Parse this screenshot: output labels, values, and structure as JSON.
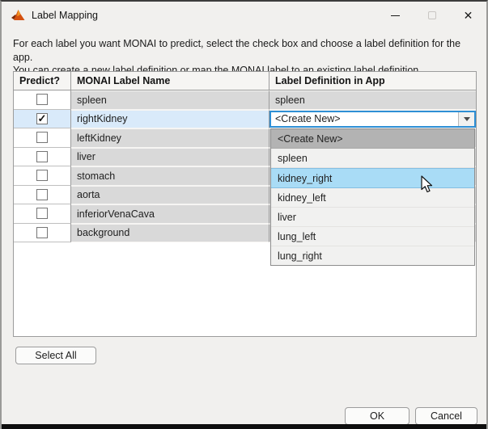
{
  "window": {
    "title": "Label Mapping"
  },
  "instructions": {
    "line1": "For each label you want MONAI to predict, select the check box and choose a label definition for the app.",
    "line2": "You can create a new label definition or map the MONAI label to an existing label definition"
  },
  "table": {
    "columns": [
      "Predict?",
      "MONAI Label Name",
      "Label Definition in App"
    ],
    "rows": [
      {
        "monai_label": "spleen",
        "checked": false,
        "selected": false,
        "definition": "spleen"
      },
      {
        "monai_label": "rightKidney",
        "checked": true,
        "selected": true,
        "definition": "<Create New>"
      },
      {
        "monai_label": "leftKidney",
        "checked": false,
        "selected": false,
        "definition": ""
      },
      {
        "monai_label": "liver",
        "checked": false,
        "selected": false,
        "definition": ""
      },
      {
        "monai_label": "stomach",
        "checked": false,
        "selected": false,
        "definition": ""
      },
      {
        "monai_label": "aorta",
        "checked": false,
        "selected": false,
        "definition": ""
      },
      {
        "monai_label": "inferiorVenaCava",
        "checked": false,
        "selected": false,
        "definition": ""
      },
      {
        "monai_label": "background",
        "checked": false,
        "selected": false,
        "definition": ""
      }
    ]
  },
  "combobox": {
    "value": "<Create New>"
  },
  "dropdown": {
    "options": [
      "<Create New>",
      "spleen",
      "kidney_right",
      "kidney_left",
      "liver",
      "lung_left",
      "lung_right"
    ],
    "selected_index": 0,
    "hover_index": 2
  },
  "buttons": {
    "select_all": "Select All",
    "ok": "OK",
    "cancel": "Cancel"
  },
  "colors": {
    "accent-blue": "#2e8fd5",
    "hover-blue": "#a9dcf6",
    "selected-row": "#d9eafa",
    "option-selected": "#b3b3b3"
  }
}
